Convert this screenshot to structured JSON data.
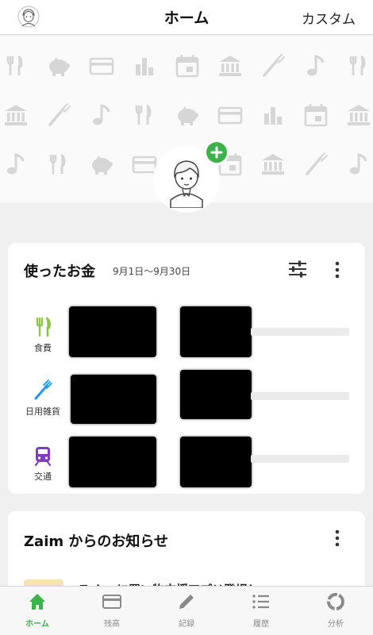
{
  "header": {
    "title": "ホーム",
    "custom_label": "カスタム"
  },
  "spending_card": {
    "title": "使ったお金",
    "date_range": "9月1日〜9月30日",
    "categories": [
      {
        "label": "食費",
        "icon": "fork-knife-icon",
        "color": "#8bc34a"
      },
      {
        "label": "日用雑貨",
        "icon": "toothbrush-icon",
        "color": "#2196f3"
      },
      {
        "label": "交通",
        "icon": "train-icon",
        "color": "#7e3fbf"
      }
    ]
  },
  "news_card": {
    "title": "Zaim からのお知らせ",
    "snippet": "Zaim に買い物支援アプリ登場！"
  },
  "tabbar": {
    "tabs": [
      {
        "label": "ホーム",
        "icon": "home-icon",
        "active": true
      },
      {
        "label": "残高",
        "icon": "card-icon",
        "active": false
      },
      {
        "label": "記録",
        "icon": "pencil-icon",
        "active": false
      },
      {
        "label": "履歴",
        "icon": "list-icon",
        "active": false
      },
      {
        "label": "分析",
        "icon": "donut-chart-icon",
        "active": false
      }
    ]
  },
  "colors": {
    "accent": "#3cb34a",
    "inactive": "#8a8a8a",
    "pattern_icon": "#d6d6d6"
  }
}
